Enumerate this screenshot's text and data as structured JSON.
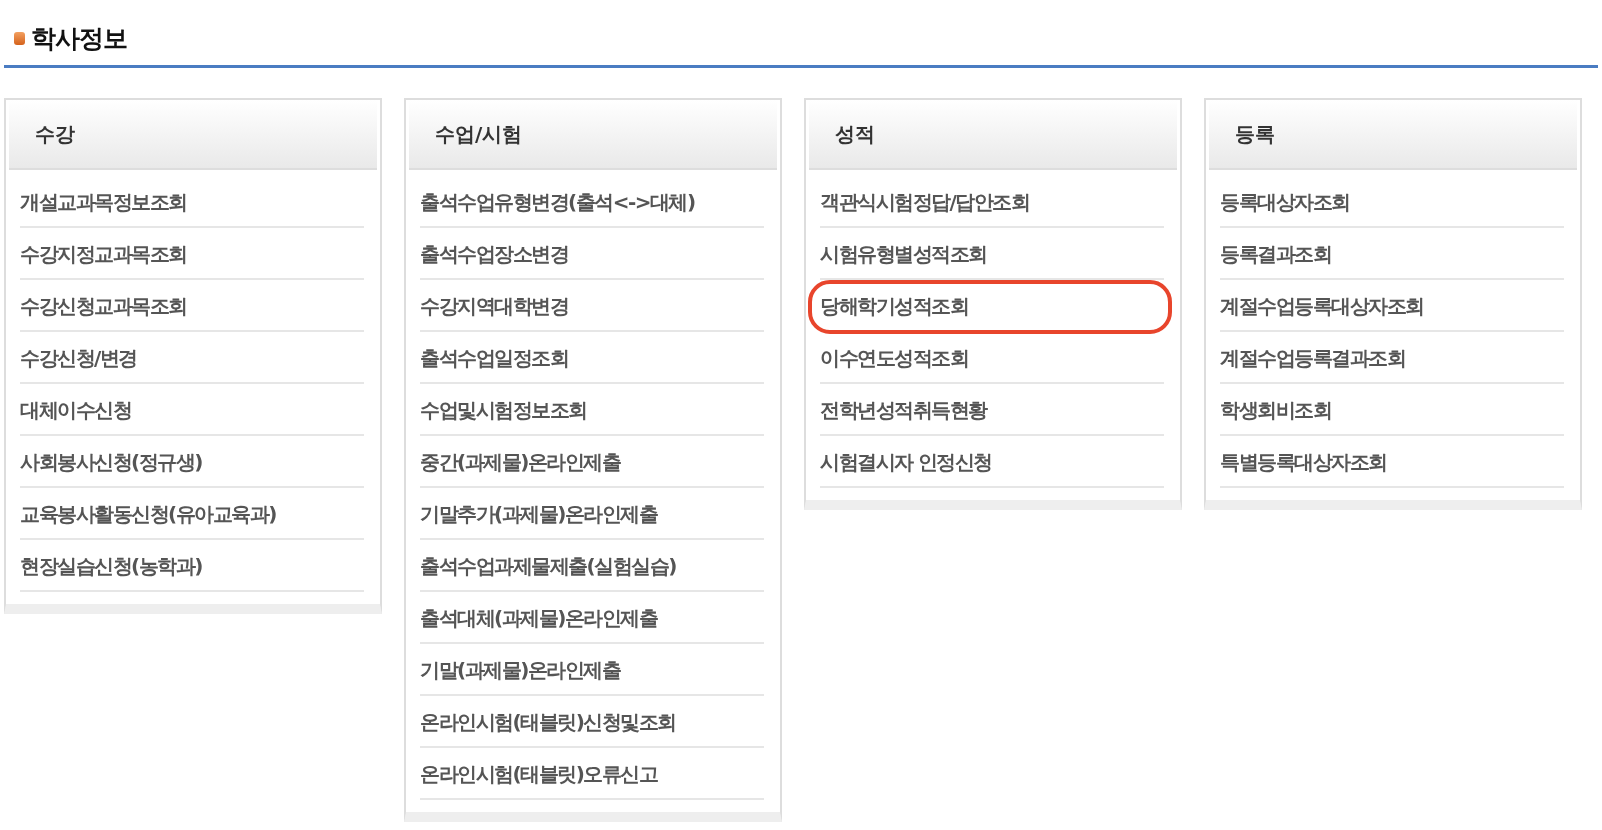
{
  "page_title": "학사정보",
  "menus": [
    {
      "title": "수강",
      "items": [
        {
          "label": "개설교과목정보조회",
          "highlighted": false
        },
        {
          "label": "수강지정교과목조회",
          "highlighted": false
        },
        {
          "label": "수강신청교과목조회",
          "highlighted": false
        },
        {
          "label": "수강신청/변경",
          "highlighted": false
        },
        {
          "label": "대체이수신청",
          "highlighted": false
        },
        {
          "label": "사회봉사신청(정규생)",
          "highlighted": false
        },
        {
          "label": "교육봉사활동신청(유아교육과)",
          "highlighted": false
        },
        {
          "label": "현장실습신청(농학과)",
          "highlighted": false
        }
      ]
    },
    {
      "title": "수업/시험",
      "items": [
        {
          "label": "출석수업유형변경(출석<->대체)",
          "highlighted": false
        },
        {
          "label": "출석수업장소변경",
          "highlighted": false
        },
        {
          "label": "수강지역대학변경",
          "highlighted": false
        },
        {
          "label": "출석수업일정조회",
          "highlighted": false
        },
        {
          "label": "수업및시험정보조회",
          "highlighted": false
        },
        {
          "label": "중간(과제물)온라인제출",
          "highlighted": false
        },
        {
          "label": "기말추가(과제물)온라인제출",
          "highlighted": false
        },
        {
          "label": "출석수업과제물제출(실험실습)",
          "highlighted": false
        },
        {
          "label": "출석대체(과제물)온라인제출",
          "highlighted": false
        },
        {
          "label": "기말(과제물)온라인제출",
          "highlighted": false
        },
        {
          "label": "온라인시험(태블릿)신청및조회",
          "highlighted": false
        },
        {
          "label": "온라인시험(태블릿)오류신고",
          "highlighted": false
        }
      ]
    },
    {
      "title": "성적",
      "items": [
        {
          "label": "객관식시험정답/답안조회",
          "highlighted": false
        },
        {
          "label": "시험유형별성적조회",
          "highlighted": false
        },
        {
          "label": "당해학기성적조회",
          "highlighted": true
        },
        {
          "label": "이수연도성적조회",
          "highlighted": false
        },
        {
          "label": "전학년성적취득현황",
          "highlighted": false
        },
        {
          "label": "시험결시자 인정신청",
          "highlighted": false
        }
      ]
    },
    {
      "title": "등록",
      "items": [
        {
          "label": "등록대상자조회",
          "highlighted": false
        },
        {
          "label": "등록결과조회",
          "highlighted": false
        },
        {
          "label": "계절수업등록대상자조회",
          "highlighted": false
        },
        {
          "label": "계절수업등록결과조회",
          "highlighted": false
        },
        {
          "label": "학생회비조회",
          "highlighted": false
        },
        {
          "label": "특별등록대상자조회",
          "highlighted": false
        }
      ]
    }
  ]
}
